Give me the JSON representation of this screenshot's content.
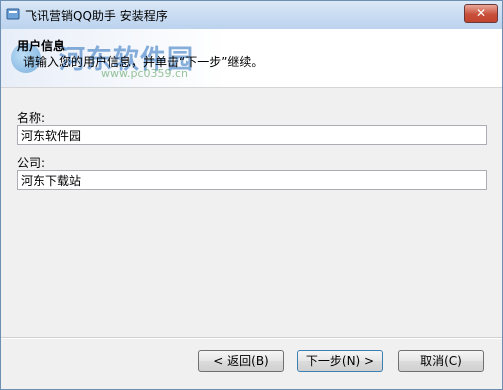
{
  "window": {
    "title": "飞讯营销QQ助手 安装程序",
    "close_label": "✕"
  },
  "watermark": {
    "text": "河东软件园",
    "url": "www.pc0359.cn"
  },
  "header": {
    "title": "用户信息",
    "description": "请输入您的用户信息，并单击“下一步”继续。"
  },
  "form": {
    "name_label": "名称:",
    "name_value": "河东软件园",
    "company_label": "公司:",
    "company_value": "河东下载站"
  },
  "buttons": {
    "back": "< 返回(B)",
    "next": "下一步(N) >",
    "cancel": "取消(C)"
  }
}
